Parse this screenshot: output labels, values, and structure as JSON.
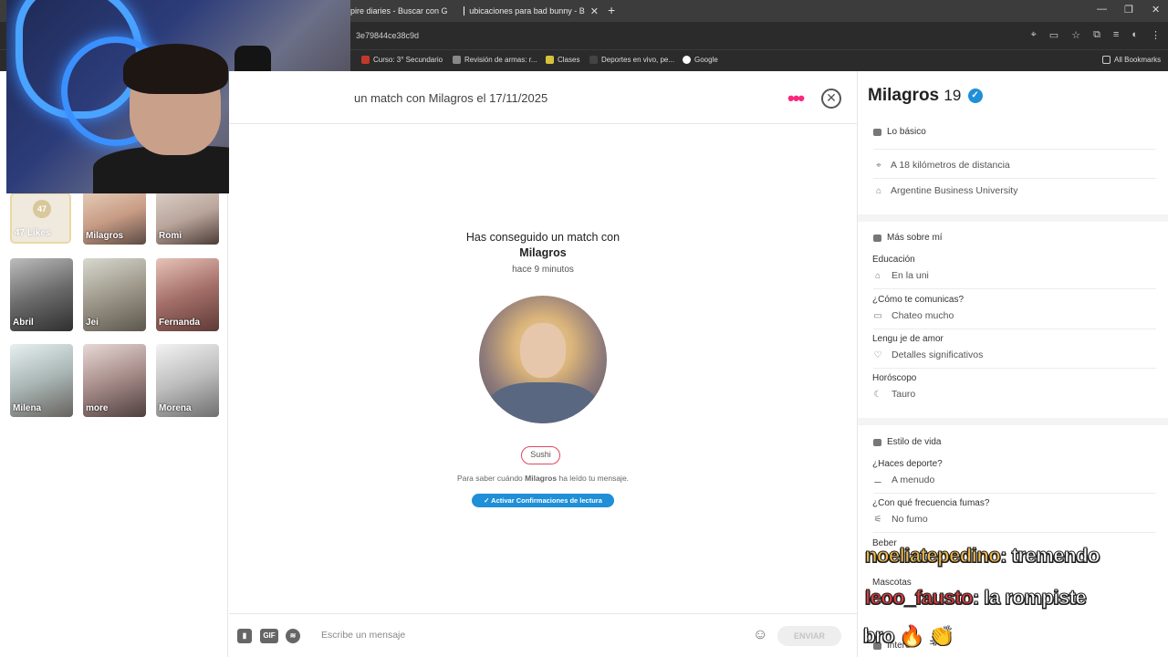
{
  "browser": {
    "tabs": [
      {
        "title": "pire diaries - Buscar con G"
      },
      {
        "title": "ubicaciones para bad bunny - B"
      }
    ],
    "url": "3e79844ce38c9d",
    "bookmarks": [
      {
        "label": "Curso: 3° Secundario"
      },
      {
        "label": "Revisión de armas: r..."
      },
      {
        "label": "Clases"
      },
      {
        "label": "Deportes en vivo, pe..."
      },
      {
        "label": "Google"
      }
    ],
    "all_bookmarks": "All Bookmarks"
  },
  "sidebar": {
    "likes_count": "47",
    "likes_label": "47 Likes",
    "matches": [
      {
        "name": "Milagros"
      },
      {
        "name": "Romi"
      },
      {
        "name": "Abril"
      },
      {
        "name": "Jei"
      },
      {
        "name": "Fernanda"
      },
      {
        "name": "Milena"
      },
      {
        "name": "more"
      },
      {
        "name": "Morena"
      }
    ]
  },
  "chat": {
    "header_title": "un match con Milagros el 17/11/2025",
    "match_text": "Has conseguido un match con",
    "match_name": "Milagros",
    "match_time": "hace 9 minutos",
    "interest_tag": "Sushi",
    "read_info_pre": "Para saber cuándo",
    "read_info_name": "Milagros",
    "read_info_post": "ha leído tu mensaje.",
    "read_button": "✓ Activar Confirmaciones de lectura",
    "composer_placeholder": "Escribe un mensaje",
    "gif_label": "GIF",
    "send_label": "ENVIAR"
  },
  "profile": {
    "name": "Milagros",
    "age": "19",
    "basics_title": "Lo básico",
    "distance": "A 18 kilómetros de distancia",
    "school": "Argentine Business University",
    "more_title": "Más sobre mí",
    "more": [
      {
        "q": "Educación",
        "a": "En la uni"
      },
      {
        "q": "¿Cómo te comunicas?",
        "a": "Chateo mucho"
      },
      {
        "q": "Lengu  je de amor",
        "a": "Detalles significativos"
      },
      {
        "q": "Horóscopo",
        "a": "Tauro"
      }
    ],
    "lifestyle_title": "Estilo de vida",
    "lifestyle": [
      {
        "q": "¿Haces deporte?",
        "a": "A menudo"
      },
      {
        "q": "¿Con qué frecuencia fumas?",
        "a": "No fumo"
      },
      {
        "q": "Beber",
        "a": ""
      },
      {
        "q": "Mascotas",
        "a": ""
      }
    ],
    "interests_title": "Intere"
  },
  "stream_overlay": {
    "line1_user": "noeliatepedino",
    "line1_msg": ": tremendo",
    "line2_user": "leoo_fausto",
    "line2_msg": ": la rompiste",
    "line3_msg": "bro 🔥 👏"
  },
  "colors": {
    "brand": "#fd267d",
    "verified": "#1f8fd8",
    "overlay_gold": "#f0b94a",
    "overlay_red": "#e23b3b"
  }
}
